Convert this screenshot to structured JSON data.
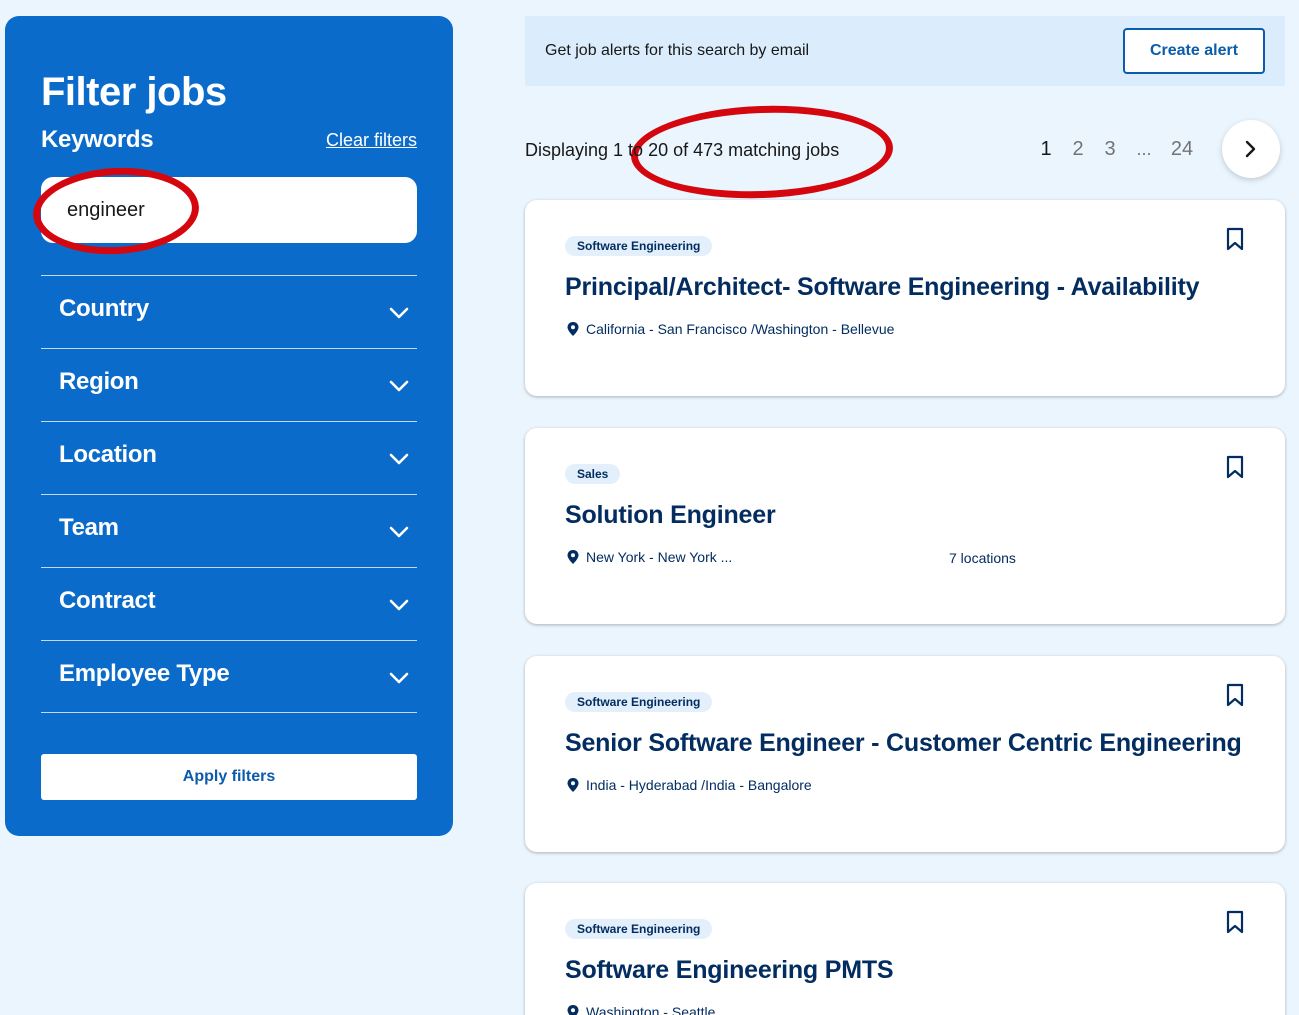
{
  "sidebar": {
    "title": "Filter jobs",
    "keywords_label": "Keywords",
    "clear_filters": "Clear filters",
    "keyword_value": "engineer",
    "filters": [
      {
        "label": "Country"
      },
      {
        "label": "Region"
      },
      {
        "label": "Location"
      },
      {
        "label": "Team"
      },
      {
        "label": "Contract"
      },
      {
        "label": "Employee Type"
      }
    ],
    "apply_label": "Apply filters"
  },
  "alert": {
    "text": "Get job alerts for this search by email",
    "button": "Create alert"
  },
  "results": {
    "display_text": "Displaying 1 to 20 of 473 matching jobs"
  },
  "pagination": {
    "pages": [
      "1",
      "2",
      "3"
    ],
    "ellipsis": "...",
    "last": "24",
    "current": "1"
  },
  "jobs": [
    {
      "tag": "Software Engineering",
      "title": "Principal/Architect- Software Engineering - Availability",
      "location": "California - San Francisco  /Washington - Bellevue"
    },
    {
      "tag": "Sales",
      "title": "Solution Engineer",
      "location": "New York - New York ...",
      "extra": "7 locations"
    },
    {
      "tag": "Software Engineering",
      "title": "Senior Software Engineer - Customer Centric Engineering",
      "location": "India - Hyderabad  /India - Bangalore"
    },
    {
      "tag": "Software Engineering",
      "title": "Software Engineering PMTS",
      "location": "Washington - Seattle"
    }
  ],
  "colors": {
    "sidebar_bg": "#0b6bcb",
    "page_bg": "#eaf5fe",
    "title_navy": "#032d60",
    "annotation_red": "#d4070f"
  }
}
